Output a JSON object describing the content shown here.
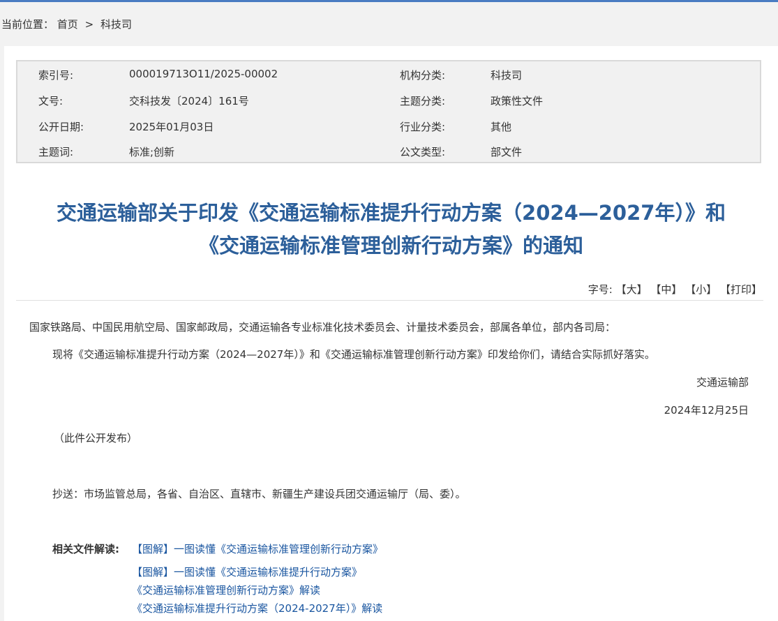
{
  "breadcrumb": {
    "prefix": "当前位置：",
    "home": "首页",
    "separator": ">",
    "current": "科技司"
  },
  "meta": {
    "index_label": "索引号:",
    "index_value": "000019713O11/2025-00002",
    "org_label": "机构分类:",
    "org_value": "科技司",
    "docno_label": "文号:",
    "docno_value": "交科技发〔2024〕161号",
    "topic_label": "主题分类:",
    "topic_value": "政策性文件",
    "date_label": "公开日期:",
    "date_value": "2025年01月03日",
    "industry_label": "行业分类:",
    "industry_value": "其他",
    "keyword_label": "主题词:",
    "keyword_value": "标准;创新",
    "doctype_label": "公文类型:",
    "doctype_value": "部文件"
  },
  "title": {
    "line1": "交通运输部关于印发《交通运输标准提升行动方案（2024—2027年）》和",
    "line2": "《交通运输标准管理创新行动方案》的通知"
  },
  "fontsize": {
    "label": "字号:",
    "large": "【大】",
    "medium": "【中】",
    "small": "【小】",
    "print": "【打印】"
  },
  "body": {
    "recipients": "国家铁路局、中国民用航空局、国家邮政局，交通运输各专业标准化技术委员会、计量技术委员会，部属各单位，部内各司局：",
    "main": "现将《交通运输标准提升行动方案（2024—2027年）》和《交通运输标准管理创新行动方案》印发给你们，请结合实际抓好落实。",
    "signer": "交通运输部",
    "sign_date": "2024年12月25日",
    "public_note": "（此件公开发布）",
    "cc": "抄送：市场监管总局，各省、自治区、直辖市、新疆生产建设兵团交通运输厅（局、委）。"
  },
  "related": {
    "label": "相关文件解读:",
    "links": [
      "【图解】一图读懂《交通运输标准管理创新行动方案》",
      "【图解】一图读懂《交通运输标准提升行动方案》",
      "《交通运输标准管理创新行动方案》解读",
      "《交通运输标准提升行动方案（2024-2027年）》解读"
    ]
  }
}
